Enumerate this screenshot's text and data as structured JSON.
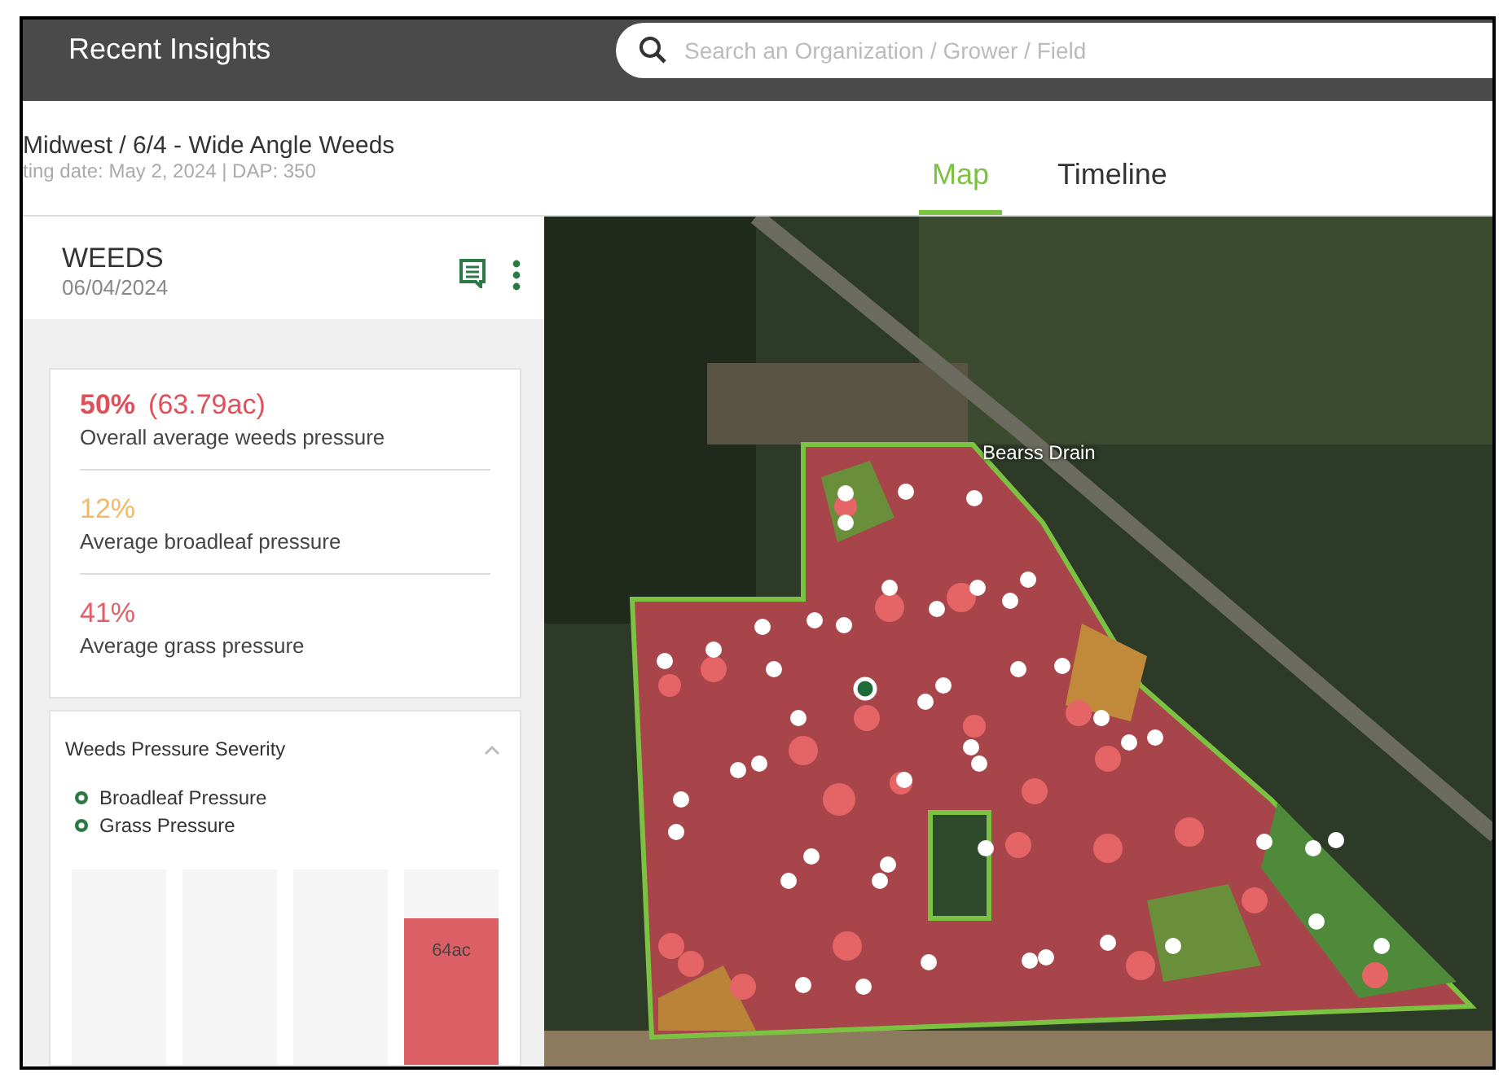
{
  "top_bar": {
    "nav_item": "Recent Insights",
    "search": {
      "placeholder": "Search an Organization / Grower / Field"
    }
  },
  "header": {
    "title": "Midwest / 6/4 - Wide Angle Weeds",
    "subtitle": "ting date: May 2, 2024 | DAP: 350"
  },
  "tabs": [
    {
      "label": "Map",
      "selected": true
    },
    {
      "label": "Timeline",
      "selected": false
    }
  ],
  "panel": {
    "title": "WEEDS",
    "date": "06/04/2024",
    "stats": [
      {
        "value": "50%",
        "extra": "(63.79ac)",
        "label": "Overall average weeds pressure",
        "color": "#e0505a"
      },
      {
        "value": "12%",
        "label": "Average broadleaf pressure",
        "color": "#f5b868"
      },
      {
        "value": "41%",
        "label": "Average grass pressure",
        "color": "#e0606a"
      }
    ],
    "severity": {
      "title": "Weeds Pressure Severity",
      "expanded": true,
      "legend": [
        "Broadleaf Pressure",
        "Grass Pressure"
      ],
      "bars": [
        {
          "level": 0
        },
        {
          "level": 0
        },
        {
          "level": 0
        },
        {
          "level": 0.75,
          "label": "64ac"
        }
      ]
    }
  },
  "map": {
    "label": "Bearss Drain"
  }
}
